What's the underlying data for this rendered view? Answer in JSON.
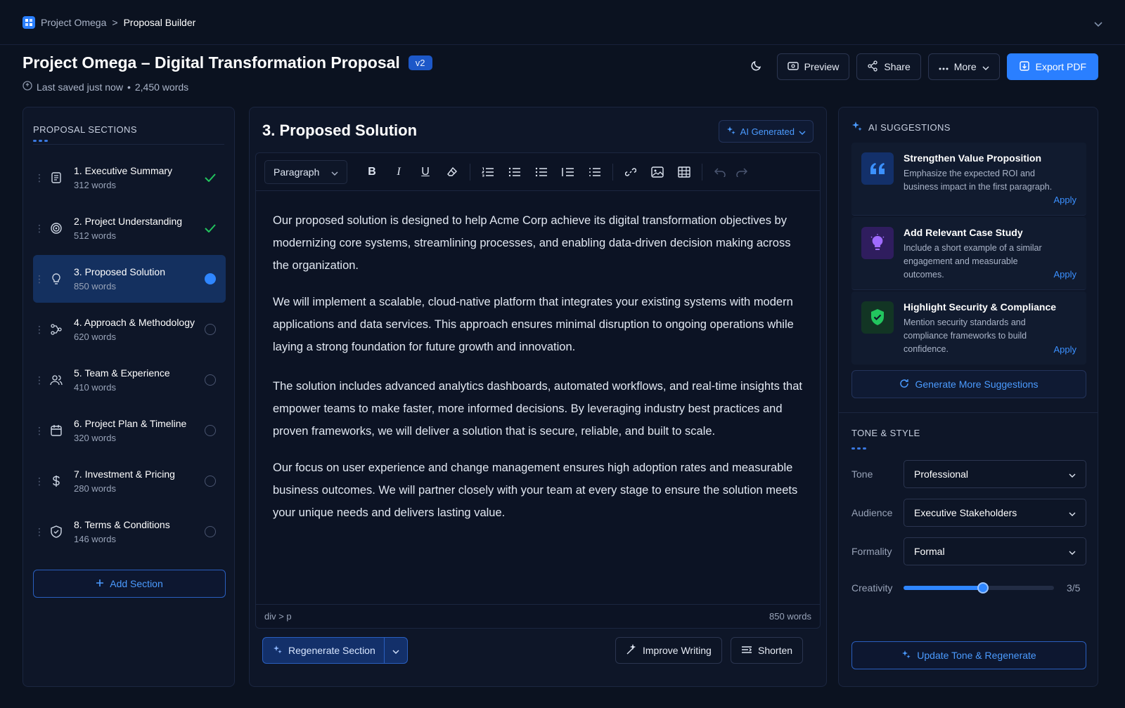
{
  "breadcrumb": {
    "project": "Project Omega",
    "separator": ">",
    "page": "Proposal Builder"
  },
  "header": {
    "title": "Project Omega – Digital Transformation Proposal",
    "version": "v2",
    "saved": "Last saved just now",
    "bullet": "•",
    "words": "2,450 words"
  },
  "actions": {
    "preview": "Preview",
    "share": "Share",
    "more": "More",
    "export": "Export PDF"
  },
  "sections": {
    "title": "PROPOSAL SECTIONS",
    "items": [
      {
        "name": "1. Executive Summary",
        "words": "312 words",
        "status": "done",
        "icon": "document-icon"
      },
      {
        "name": "2. Project Understanding",
        "words": "512 words",
        "status": "done",
        "icon": "target-icon"
      },
      {
        "name": "3. Proposed Solution",
        "words": "850 words",
        "status": "active",
        "icon": "lightbulb-icon"
      },
      {
        "name": "4. Approach & Methodology",
        "words": "620 words",
        "status": "pending",
        "icon": "flow-icon"
      },
      {
        "name": "5. Team & Experience",
        "words": "410 words",
        "status": "pending",
        "icon": "users-icon"
      },
      {
        "name": "6. Project Plan & Timeline",
        "words": "320 words",
        "status": "pending",
        "icon": "calendar-icon"
      },
      {
        "name": "7. Investment & Pricing",
        "words": "280 words",
        "status": "pending",
        "icon": "dollar-icon"
      },
      {
        "name": "8. Terms & Conditions",
        "words": "146 words",
        "status": "pending",
        "icon": "shield-icon"
      }
    ],
    "add": "Add Section"
  },
  "editor": {
    "section_title": "3. Proposed Solution",
    "ai_badge": "AI Generated",
    "format_select": "Paragraph",
    "paragraphs": [
      "Our proposed solution is designed to help Acme Corp achieve its digital transformation objectives by modernizing core systems, streamlining processes, and enabling data-driven decision making across the organization.",
      "We will implement a scalable, cloud-native platform that integrates your existing systems with modern applications and data services. This approach ensures minimal disruption to ongoing operations while laying a strong foundation for future growth and innovation.",
      "The solution includes advanced analytics dashboards, automated workflows, and real-time insights that empower teams to make faster, more informed decisions. By leveraging industry best practices and proven frameworks, we will deliver a solution that is secure, reliable, and built to scale.",
      "Our focus on user experience and change management ensures high adoption rates and measurable business outcomes. We will partner closely with your team at every stage to ensure the solution meets your unique needs and delivers lasting value."
    ],
    "path": "div > p",
    "word_count": "850 words",
    "regenerate": "Regenerate Section",
    "improve": "Improve Writing",
    "shorten": "Shorten"
  },
  "ai": {
    "title": "AI SUGGESTIONS",
    "suggestions": [
      {
        "title": "Strengthen Value Proposition",
        "desc": "Emphasize the expected ROI and business impact in the first paragraph.",
        "apply": "Apply",
        "icon": "quote-icon",
        "color": "#2a7fff"
      },
      {
        "title": "Add Relevant Case Study",
        "desc": "Include a short example of a similar engagement and measurable outcomes.",
        "apply": "Apply",
        "icon": "lightbulb-icon",
        "color": "#9b59ff"
      },
      {
        "title": "Highlight Security & Compliance",
        "desc": "Mention security standards and compliance frameworks to build confidence.",
        "apply": "Apply",
        "icon": "shield-check-icon",
        "color": "#22c55e"
      }
    ],
    "generate_more": "Generate More Suggestions"
  },
  "tone": {
    "title": "TONE & STYLE",
    "tone_label": "Tone",
    "tone_value": "Professional",
    "audience_label": "Audience",
    "audience_value": "Executive Stakeholders",
    "formality_label": "Formality",
    "formality_value": "Formal",
    "creativity_label": "Creativity",
    "creativity_value": "3/5",
    "creativity_level": 3,
    "creativity_max": 5,
    "update": "Update Tone & Regenerate"
  }
}
